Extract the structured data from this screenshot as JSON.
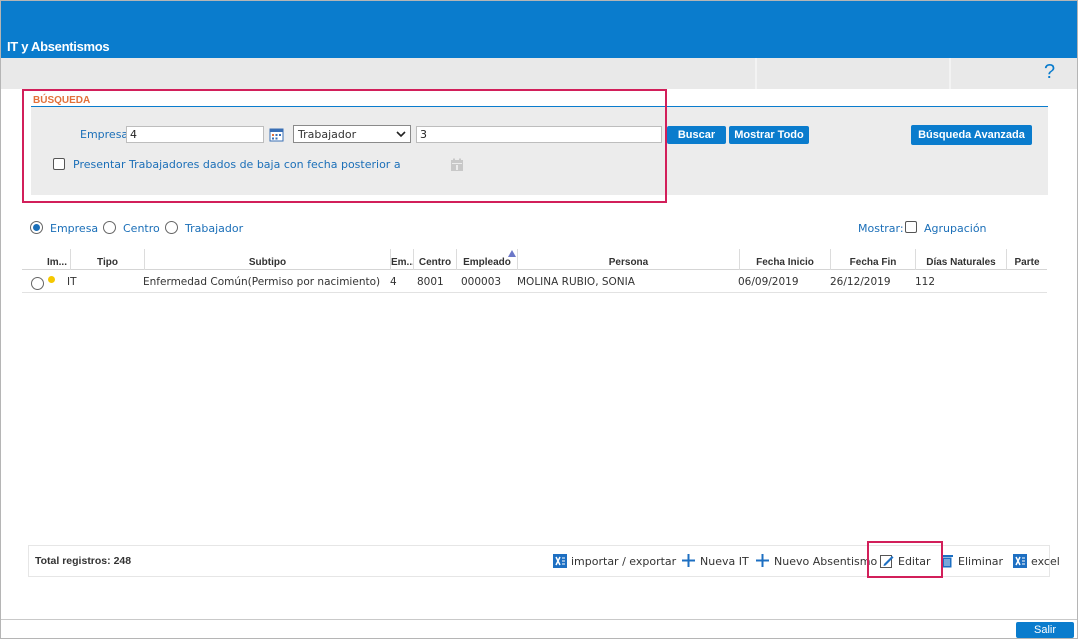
{
  "app": {
    "title": "IT y Absentismos",
    "help_symbol": "?"
  },
  "search": {
    "section_label": "BÚSQUEDA",
    "empresa_label": "Empresa",
    "empresa_value": "4",
    "type_selected": "Trabajador",
    "type_value": "3",
    "buscar_label": "Buscar",
    "mostrar_todo_label": "Mostrar Todo",
    "avanzada_label": "Búsqueda Avanzada",
    "baja_checkbox_label": "Presentar Trabajadores dados de baja con fecha posterior a"
  },
  "scope": {
    "options": [
      "Empresa",
      "Centro",
      "Trabajador"
    ],
    "selected": "Empresa",
    "mostrar_label": "Mostrar:",
    "agrupacion_label": "Agrupación"
  },
  "table": {
    "columns": [
      "Im...",
      "Tipo",
      "Subtipo",
      "Em...",
      "Centro",
      "Empleado",
      "Persona",
      "Fecha Inicio",
      "Fecha Fin",
      "Días Naturales",
      "Parte"
    ],
    "rows": [
      {
        "tipo": "IT",
        "subtipo": "Enfermedad Común(Permiso por nacimiento)",
        "empresa": "4",
        "centro": "8001",
        "empleado": "000003",
        "persona": "MOLINA RUBIO, SONIA",
        "fecha_inicio": "06/09/2019",
        "fecha_fin": "26/12/2019",
        "dias": "112",
        "parte": ""
      }
    ]
  },
  "footer": {
    "total": "Total registros: 248",
    "import_export": "importar / exportar",
    "nueva_it": "Nueva IT",
    "nuevo_absentismo": "Nuevo Absentismo",
    "editar": "Editar",
    "eliminar": "Eliminar",
    "excel": "excel"
  },
  "salir_label": "Salir",
  "colors": {
    "brand": "#0a7ccd",
    "highlight": "#d21f5a",
    "section": "#e2703a"
  }
}
